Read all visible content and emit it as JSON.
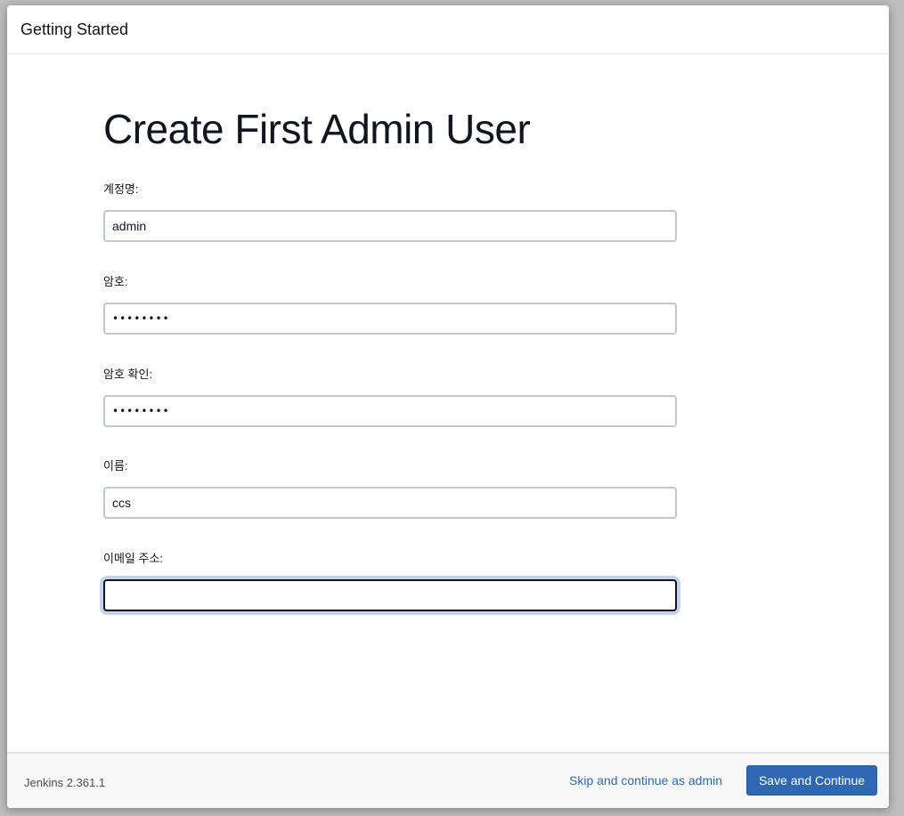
{
  "dialog": {
    "title": "Getting Started"
  },
  "page": {
    "heading": "Create First Admin User"
  },
  "form": {
    "username": {
      "label": "계정명:",
      "value": "admin"
    },
    "password": {
      "label": "암호:",
      "value": "••••••••"
    },
    "password_confirm": {
      "label": "암호 확인:",
      "value": "••••••••"
    },
    "full_name": {
      "label": "이름:",
      "value": "ccs"
    },
    "email": {
      "label": "이메일 주소:",
      "value": ""
    }
  },
  "footer": {
    "version": "Jenkins 2.361.1",
    "skip_label": "Skip and continue as admin",
    "save_label": "Save and Continue"
  },
  "colors": {
    "primary": "#2f67b3",
    "text": "#14141f",
    "focus_ring": "#c5d4e8"
  }
}
